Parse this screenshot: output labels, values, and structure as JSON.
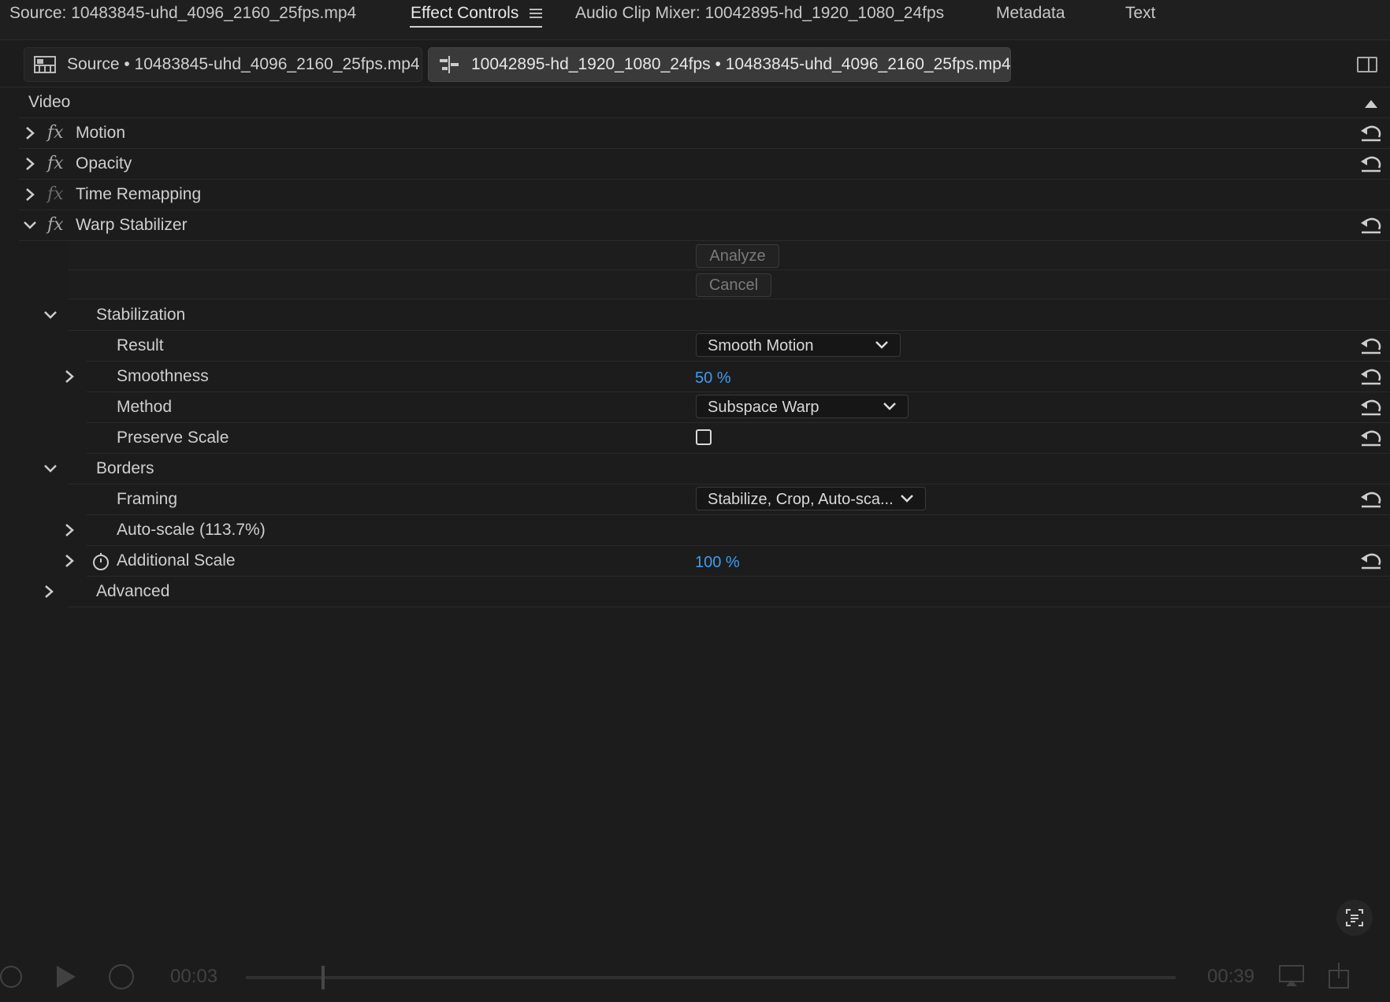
{
  "tabs": [
    {
      "label": "Source: 10483845-uhd_4096_2160_25fps.mp4"
    },
    {
      "label": "Effect Controls"
    },
    {
      "label": "Audio Clip Mixer: 10042895-hd_1920_1080_24fps"
    },
    {
      "label": "Metadata"
    },
    {
      "label": "Text"
    }
  ],
  "clip_tabs": {
    "source": "Source • 10483845-uhd_4096_2160_25fps.mp4",
    "sequence": "10042895-hd_1920_1080_24fps • 10483845-uhd_4096_2160_25fps.mp4"
  },
  "section": {
    "label": "Video"
  },
  "effects": {
    "motion": "Motion",
    "opacity": "Opacity",
    "time_remapping": "Time Remapping",
    "warp_stabilizer": "Warp Stabilizer"
  },
  "fx_symbol": "fx",
  "buttons": {
    "analyze": "Analyze",
    "cancel": "Cancel"
  },
  "stabilization": {
    "label": "Stabilization",
    "result": {
      "label": "Result",
      "value": "Smooth Motion"
    },
    "smoothness": {
      "label": "Smoothness",
      "value": "50 %"
    },
    "method": {
      "label": "Method",
      "value": "Subspace Warp"
    },
    "preserve_scale": {
      "label": "Preserve Scale",
      "checked": false
    }
  },
  "borders": {
    "label": "Borders",
    "framing": {
      "label": "Framing",
      "value": "Stabilize, Crop, Auto-sca..."
    },
    "auto_scale": {
      "label": "Auto-scale (113.7%)"
    },
    "additional_scale": {
      "label": "Additional Scale",
      "value": "100 %"
    }
  },
  "advanced": {
    "label": "Advanced"
  },
  "playback": {
    "current_time": "00:03",
    "total_time": "00:39"
  },
  "icons": {
    "reset": "reset-icon",
    "chevron_right": "chevron-right-icon",
    "chevron_down": "chevron-down-icon",
    "stopwatch": "stopwatch-icon"
  },
  "colors": {
    "value_blue": "#3e9cf0",
    "background": "#1c1c1c"
  }
}
